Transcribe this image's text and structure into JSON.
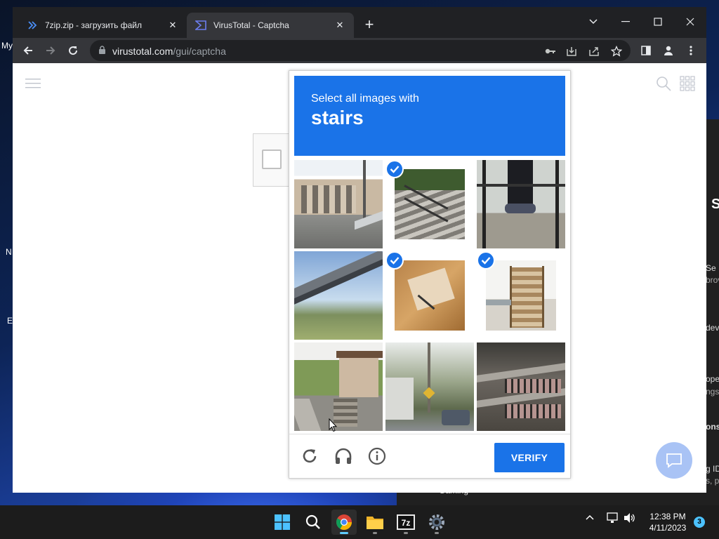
{
  "desktop": {
    "icon_labels": [
      "My",
      "N",
      "E"
    ]
  },
  "background_window": {
    "fragments": [
      "S",
      "Se",
      "brov",
      "dev",
      "ope",
      "ngs",
      "ons",
      "g ID",
      "s, p",
      "Gaming"
    ]
  },
  "browser": {
    "tabs": [
      {
        "title": "7zip.zip - загрузить файл",
        "active": false
      },
      {
        "title": "VirusTotal - Captcha",
        "active": true
      }
    ],
    "address": {
      "domain": "virustotal.com",
      "path": "/gui/captcha"
    }
  },
  "captcha": {
    "instruction": "Select all images with",
    "target": "stairs",
    "tiles": [
      {
        "selected": false,
        "desc": "building-road"
      },
      {
        "selected": true,
        "desc": "outdoor-stairs-railing"
      },
      {
        "selected": false,
        "desc": "person-legs-fence"
      },
      {
        "selected": false,
        "desc": "elevated-highway"
      },
      {
        "selected": true,
        "desc": "cardboard-box"
      },
      {
        "selected": true,
        "desc": "wooden-stairs"
      },
      {
        "selected": false,
        "desc": "house-steps"
      },
      {
        "selected": false,
        "desc": "street-trees"
      },
      {
        "selected": false,
        "desc": "building-balconies"
      }
    ],
    "verify_label": "VERIFY"
  },
  "taskbar": {
    "time": "12:38 PM",
    "date": "4/11/2023",
    "notification_count": "3",
    "apps": [
      "start",
      "search",
      "chrome",
      "file-explorer",
      "7zip",
      "settings"
    ]
  },
  "colors": {
    "accent": "#1a73e8",
    "chrome_dark": "#202124",
    "chrome_tab": "#35363a"
  }
}
